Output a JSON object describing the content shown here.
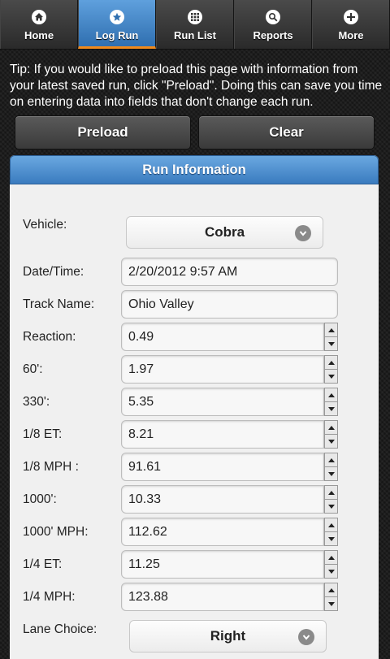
{
  "nav": {
    "items": [
      {
        "label": "Home",
        "icon": "home-icon"
      },
      {
        "label": "Log Run",
        "icon": "star-icon"
      },
      {
        "label": "Run List",
        "icon": "grid-icon"
      },
      {
        "label": "Reports",
        "icon": "search-icon"
      },
      {
        "label": "More",
        "icon": "plus-icon"
      }
    ],
    "active_index": 1
  },
  "tip": "Tip: If you would like to preload this page with information from your latest saved run, click \"Preload\". Doing this can save you time on entering data into fields that don't change each run.",
  "buttons": {
    "preload": "Preload",
    "clear": "Clear"
  },
  "panel": {
    "title": "Run Information"
  },
  "form": {
    "vehicle": {
      "label": "Vehicle:",
      "value": "Cobra"
    },
    "datetime": {
      "label": "Date/Time:",
      "value": "2/20/2012 9:57 AM"
    },
    "track": {
      "label": "Track Name:",
      "value": "Ohio Valley"
    },
    "reaction": {
      "label": "Reaction:",
      "value": "0.49"
    },
    "sixty": {
      "label": "60':",
      "value": "1.97"
    },
    "three30": {
      "label": "330':",
      "value": "5.35"
    },
    "eighth_et": {
      "label": "1/8 ET:",
      "value": "8.21"
    },
    "eighth_mph": {
      "label": "1/8 MPH :",
      "value": "91.61"
    },
    "thousand": {
      "label": "1000':",
      "value": "10.33"
    },
    "thousand_mph": {
      "label": "1000' MPH:",
      "value": "112.62"
    },
    "quarter_et": {
      "label": "1/4 ET:",
      "value": "11.25"
    },
    "quarter_mph": {
      "label": "1/4 MPH:",
      "value": "123.88"
    },
    "lane": {
      "label": "Lane Choice:",
      "value": "Right"
    }
  },
  "colors": {
    "accent": "#3a7bbf",
    "active_underline": "#f08a1c"
  }
}
